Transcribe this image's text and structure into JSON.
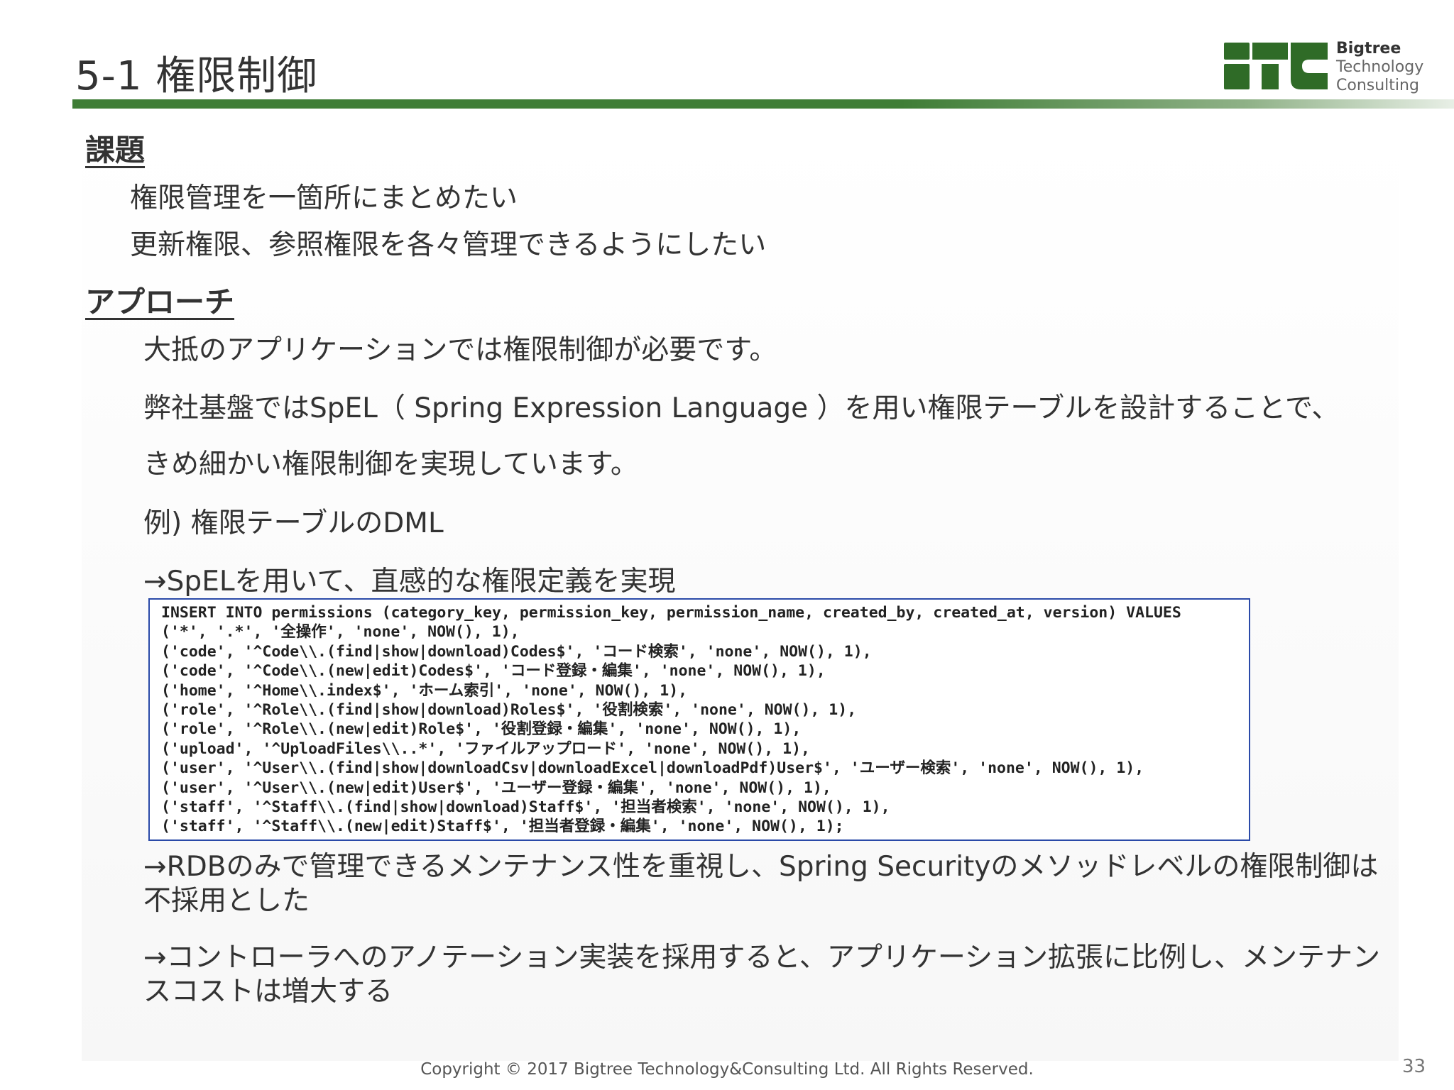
{
  "slide": {
    "title": "5-1 権限制御",
    "page_number": "33",
    "copyright": "Copyright © 2017 Bigtree Technology&Consulting Ltd. All Rights Reserved."
  },
  "logo": {
    "line1": "Bigtree",
    "line2": "Technology",
    "line3": "Consulting",
    "brand_color": "#2f6b27"
  },
  "issue": {
    "heading": "課題",
    "items": [
      "権限管理を一箇所にまとめたい",
      "更新権限、参照権限を各々管理できるようにしたい"
    ]
  },
  "approach": {
    "heading": "アプローチ",
    "lines": [
      "大抵のアプリケーションでは権限制御が必要です。",
      "弊社基盤ではSpEL（ Spring Expression Language ）を用い権限テーブルを設計することで、",
      "きめ細かい権限制御を実現しています。",
      "例) 権限テーブルのDML",
      "→SpELを用いて、直感的な権限定義を実現"
    ],
    "notes": [
      "→RDBのみで管理できるメンテナンス性を重視し、Spring Securityのメソッドレベルの権限制御は不採用とした",
      "→コントローラへのアノテーション実装を採用すると、アプリケーション拡張に比例し、メンテナンスコストは増大する"
    ]
  },
  "code": {
    "lines": [
      "INSERT INTO permissions (category_key, permission_key, permission_name, created_by, created_at, version) VALUES",
      "('*', '.*', '全操作', 'none', NOW(), 1),",
      "('code', '^Code\\\\.(find|show|download)Codes$', 'コード検索', 'none', NOW(), 1),",
      "('code', '^Code\\\\.(new|edit)Codes$', 'コード登録・編集', 'none', NOW(), 1),",
      "('home', '^Home\\\\.index$', 'ホーム索引', 'none', NOW(), 1),",
      "('role', '^Role\\\\.(find|show|download)Roles$', '役割検索', 'none', NOW(), 1),",
      "('role', '^Role\\\\.(new|edit)Role$', '役割登録・編集', 'none', NOW(), 1),",
      "('upload', '^UploadFiles\\\\..*', 'ファイルアップロード', 'none', NOW(), 1),",
      "('user', '^User\\\\.(find|show|downloadCsv|downloadExcel|downloadPdf)User$', 'ユーザー検索', 'none', NOW(), 1),",
      "('user', '^User\\\\.(new|edit)User$', 'ユーザー登録・編集', 'none', NOW(), 1),",
      "('staff', '^Staff\\\\.(find|show|download)Staff$', '担当者検索', 'none', NOW(), 1),",
      "('staff', '^Staff\\\\.(new|edit)Staff$', '担当者登録・編集', 'none', NOW(), 1);"
    ]
  }
}
